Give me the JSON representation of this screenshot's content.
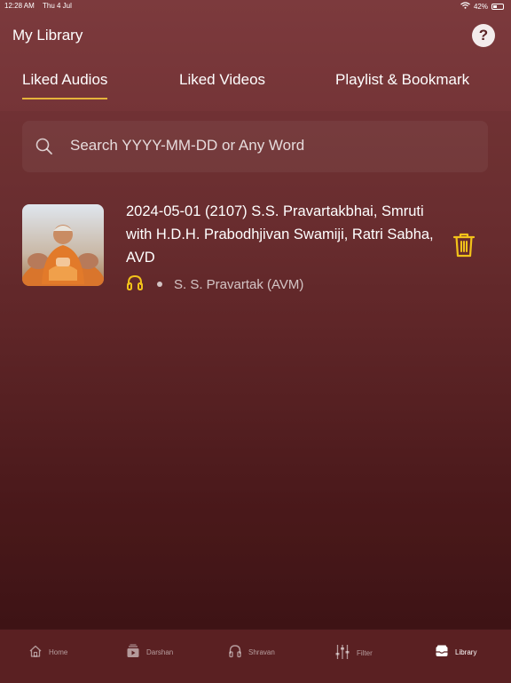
{
  "status_bar": {
    "time": "12:28 AM",
    "date": "Thu 4 Jul",
    "battery": "42%",
    "battery_level": 0.42,
    "icons": [
      "wifi-icon",
      "battery-icon"
    ]
  },
  "header": {
    "title": "My Library",
    "help_label": "?"
  },
  "tabs": [
    {
      "label": "Liked Audios",
      "active": true
    },
    {
      "label": "Liked Videos",
      "active": false
    },
    {
      "label": "Playlist & Bookmark",
      "active": false
    }
  ],
  "search": {
    "placeholder": "Search YYYY-MM-DD or Any Word",
    "icon": "search-icon"
  },
  "items": [
    {
      "title": "2024-05-01 (2107) S.S. Pravartakbhai, Smruti with H.D.H. Prabodhjivan Swamiji, Ratri Sabha, AVD",
      "author": "S. S. Pravartak (AVM)",
      "type_icon": "headphones-icon",
      "action_icon": "trash-icon"
    }
  ],
  "bottom_nav": [
    {
      "label": "Home",
      "icon": "home-icon",
      "active": false
    },
    {
      "label": "Darshan",
      "icon": "darshan-icon",
      "active": false
    },
    {
      "label": "Shravan",
      "icon": "headphones-icon",
      "active": false
    },
    {
      "label": "Filter",
      "icon": "filter-icon",
      "active": false
    },
    {
      "label": "Library",
      "icon": "library-icon",
      "active": true
    }
  ],
  "colors": {
    "background": "#6d2e30",
    "accent": "#e5b33b",
    "nav_background": "#5a2022"
  }
}
